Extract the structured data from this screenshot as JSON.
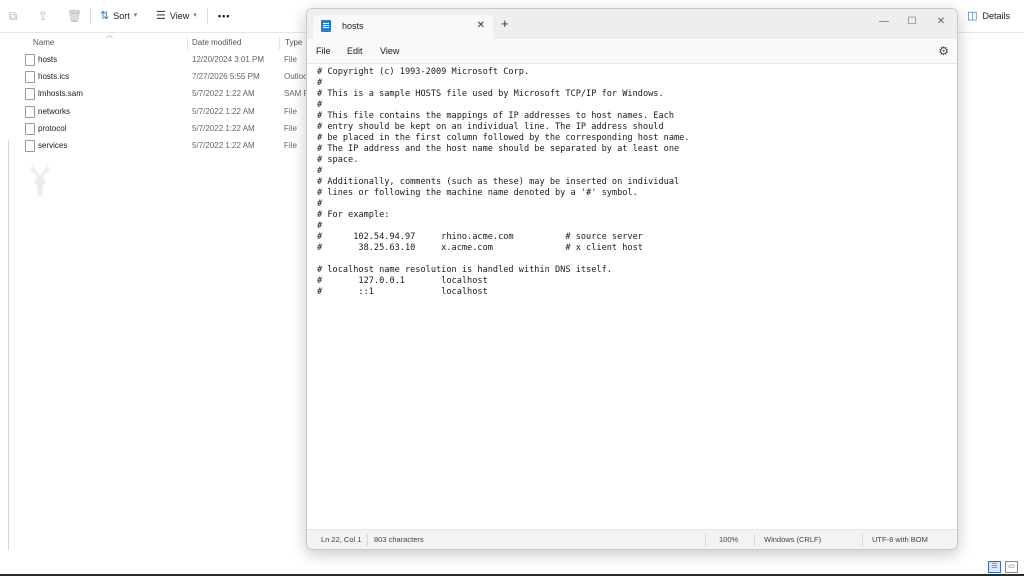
{
  "explorer": {
    "toolbar": {
      "sort_label": "Sort",
      "view_label": "View",
      "more_label": "•••",
      "details_label": "Details"
    },
    "columns": {
      "name": "Name",
      "date": "Date modified",
      "type": "Type"
    },
    "files": [
      {
        "name": "hosts",
        "date": "12/20/2024 3:01 PM",
        "type": "File"
      },
      {
        "name": "hosts.ics",
        "date": "7/27/2026 5:55 PM",
        "type": "Outlook"
      },
      {
        "name": "lmhosts.sam",
        "date": "5/7/2022 1:22 AM",
        "type": "SAM File"
      },
      {
        "name": "networks",
        "date": "5/7/2022 1:22 AM",
        "type": "File"
      },
      {
        "name": "protocol",
        "date": "5/7/2022 1:22 AM",
        "type": "File"
      },
      {
        "name": "services",
        "date": "5/7/2022 1:22 AM",
        "type": "File"
      }
    ]
  },
  "notepad": {
    "tab_title": "hosts",
    "menu": {
      "file": "File",
      "edit": "Edit",
      "view": "View"
    },
    "content": "# Copyright (c) 1993-2009 Microsoft Corp.\n#\n# This is a sample HOSTS file used by Microsoft TCP/IP for Windows.\n#\n# This file contains the mappings of IP addresses to host names. Each\n# entry should be kept on an individual line. The IP address should\n# be placed in the first column followed by the corresponding host name.\n# The IP address and the host name should be separated by at least one\n# space.\n#\n# Additionally, comments (such as these) may be inserted on individual\n# lines or following the machine name denoted by a '#' symbol.\n#\n# For example:\n#\n#      102.54.94.97     rhino.acme.com          # source server\n#       38.25.63.10     x.acme.com              # x client host\n\n# localhost name resolution is handled within DNS itself.\n#\t127.0.0.1       localhost\n#\t::1             localhost",
    "status": {
      "position": "Ln 22, Col 1",
      "characters": "803 characters",
      "zoom": "100%",
      "line_ending": "Windows (CRLF)",
      "encoding": "UTF-8 with BOM"
    }
  }
}
